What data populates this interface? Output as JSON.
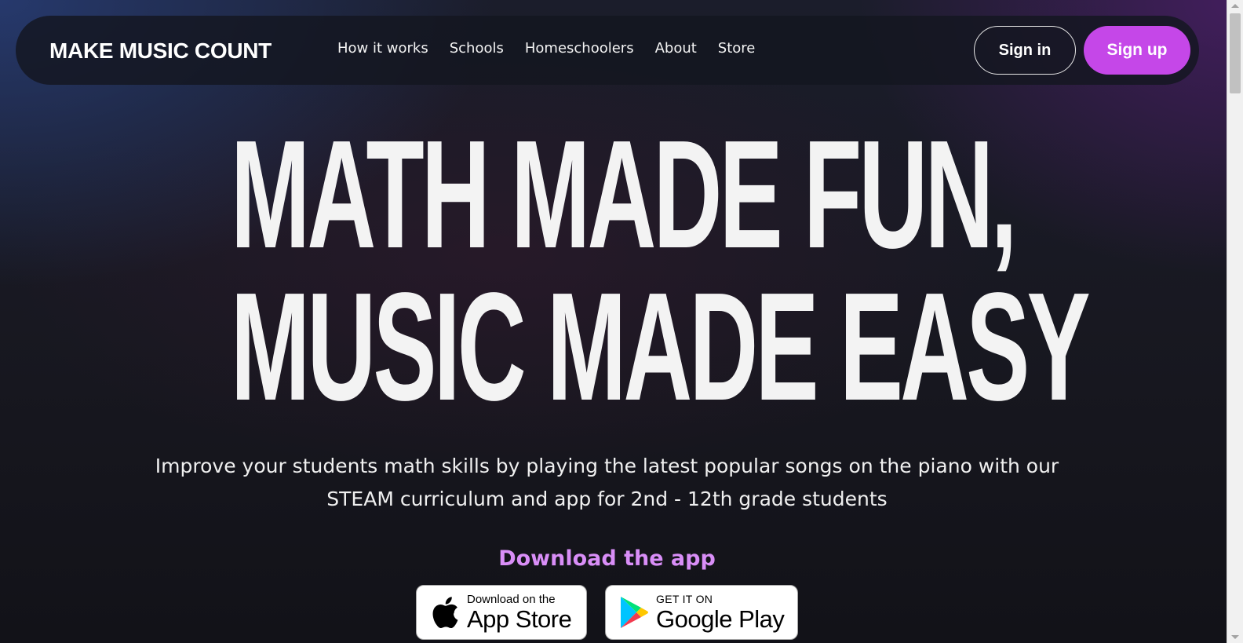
{
  "brand": {
    "logo_text": "MAKE MUSIC COUNT"
  },
  "nav": {
    "links": [
      "How it works",
      "Schools",
      "Homeschoolers",
      "About",
      "Store"
    ],
    "signin_label": "Sign in",
    "signup_label": "Sign up"
  },
  "hero": {
    "title_line1": "MATH MADE FUN,",
    "title_line2": "MUSIC MADE EASY",
    "subtitle": "Improve your students math skills by playing the latest popular songs on the piano with our STEAM curriculum and app for 2nd - 12th grade students"
  },
  "download": {
    "label": "Download the app",
    "app_store": {
      "small": "Download on the",
      "big": "App Store",
      "icon": "apple-icon"
    },
    "google_play": {
      "small": "GET IT ON",
      "big": "Google Play",
      "icon": "google-play-icon"
    }
  },
  "colors": {
    "accent": "#c547e8",
    "download_label": "#d98ef7",
    "background": "#15161c"
  }
}
